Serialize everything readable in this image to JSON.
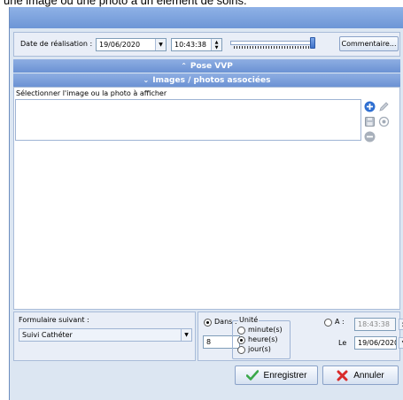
{
  "caption": "une image ou une photo à un élément de soins.",
  "toolbar": {
    "date_label": "Date de réalisation :",
    "date_value": "19/06/2020",
    "time_value": "10:43:38",
    "comment_button": "Commentaire..."
  },
  "sections": {
    "pose_title": "Pose VVP",
    "images_title": "Images / photos associées",
    "collapse_icon": "chevron-up-double-icon",
    "expand_icon": "chevron-down-double-icon"
  },
  "images_panel": {
    "instruction": "Sélectionner l'image ou la photo à afficher",
    "tools": [
      "add-icon",
      "edit-icon",
      "save-icon",
      "target-icon",
      "remove-icon"
    ]
  },
  "next_form": {
    "label": "Formulaire suivant :",
    "selected": "Suivi Cathéter"
  },
  "schedule": {
    "dans_label": "Dans :",
    "dans_value": "8",
    "unit_title": "Unité",
    "units": [
      "minute(s)",
      "heure(s)",
      "jour(s)"
    ],
    "selected_unit": "heure(s)",
    "a_label": "A :",
    "a_time": "18:43:38",
    "le_label": "Le",
    "le_date": "19/06/2020"
  },
  "actions": {
    "save": "Enregistrer",
    "cancel": "Annuler"
  },
  "colors": {
    "title_blue": "#6d95d6",
    "save_green": "#3aa84a",
    "cancel_red": "#d92b2b",
    "add_blue": "#2f6fd1"
  }
}
